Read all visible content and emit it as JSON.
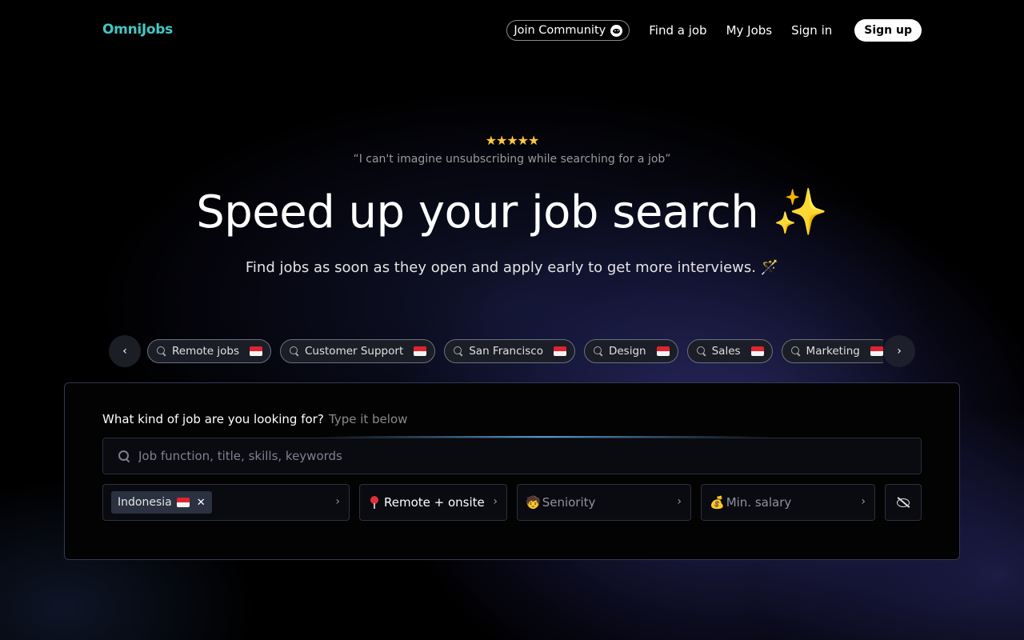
{
  "nav": {
    "logo": "OmniJobs",
    "community_label": "Join Community",
    "links": [
      "Find a job",
      "My Jobs",
      "Sign in"
    ],
    "signup_label": "Sign up"
  },
  "hero": {
    "stars": "★★★★★",
    "quote": "“I can't imagine unsubscribing while searching for a job”",
    "headline": "Speed up your job search ✨",
    "subline": "Find jobs as soon as they open and apply early to get more interviews. 🪄"
  },
  "chips": [
    {
      "label": "Remote jobs"
    },
    {
      "label": "Customer Support"
    },
    {
      "label": "San Francisco"
    },
    {
      "label": "Design"
    },
    {
      "label": "Sales"
    },
    {
      "label": "Marketing"
    }
  ],
  "search": {
    "question": "What kind of job are you looking for?",
    "hint": "Type it below",
    "placeholder": "Job function, title, skills, keywords",
    "country_tag": "Indonesia",
    "remote_label": "Remote + onsite",
    "seniority_emoji": "🧒",
    "seniority_label": "Seniority",
    "salary_emoji": "💰",
    "salary_label": "Min. salary"
  },
  "colors": {
    "logo": "#43c7c4",
    "card_border": "#323a55",
    "chip_border": "#6c7080"
  }
}
